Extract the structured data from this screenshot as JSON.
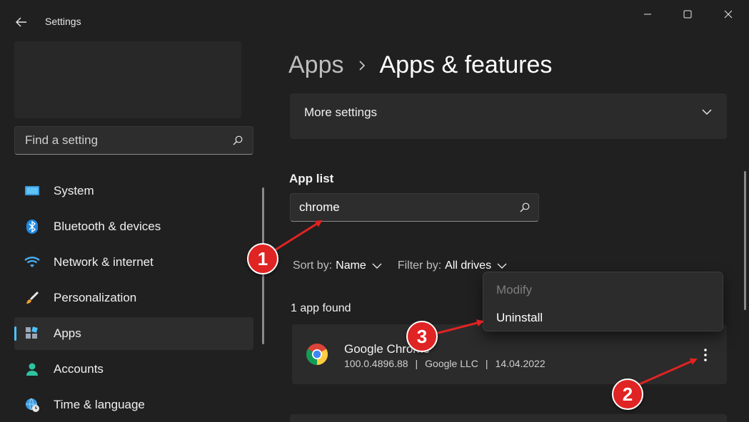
{
  "window": {
    "title": "Settings",
    "back_icon": "arrow-left-icon",
    "minimize_icon": "minimize-icon",
    "maximize_icon": "maximize-icon",
    "close_icon": "close-icon"
  },
  "sidebar": {
    "search_placeholder": "Find a setting",
    "items": [
      {
        "label": "System",
        "icon": "monitor-icon",
        "active": false
      },
      {
        "label": "Bluetooth & devices",
        "icon": "bluetooth-icon",
        "active": false
      },
      {
        "label": "Network & internet",
        "icon": "wifi-icon",
        "active": false
      },
      {
        "label": "Personalization",
        "icon": "brush-icon",
        "active": false
      },
      {
        "label": "Apps",
        "icon": "apps-icon",
        "active": true
      },
      {
        "label": "Accounts",
        "icon": "person-icon",
        "active": false
      },
      {
        "label": "Time & language",
        "icon": "globe-clock-icon",
        "active": false
      }
    ]
  },
  "main": {
    "breadcrumb": {
      "parent": "Apps",
      "current": "Apps & features"
    },
    "more_settings": "More settings",
    "app_list_title": "App list",
    "app_search_value": "chrome",
    "sort": {
      "label": "Sort by:",
      "value": "Name"
    },
    "filter": {
      "label": "Filter by:",
      "value": "All drives"
    },
    "count_text": "1 app found",
    "app": {
      "name": "Google Chrome",
      "version": "100.0.4896.88",
      "publisher": "Google LLC",
      "date": "14.04.2022"
    }
  },
  "context_menu": {
    "modify": "Modify",
    "uninstall": "Uninstall"
  },
  "annotations": {
    "badge_1": "1",
    "badge_2": "2",
    "badge_3": "3"
  },
  "colors": {
    "background": "#202020",
    "card": "#2b2b2b",
    "accent": "#4cc2ff",
    "annotation_red": "#e02323"
  }
}
